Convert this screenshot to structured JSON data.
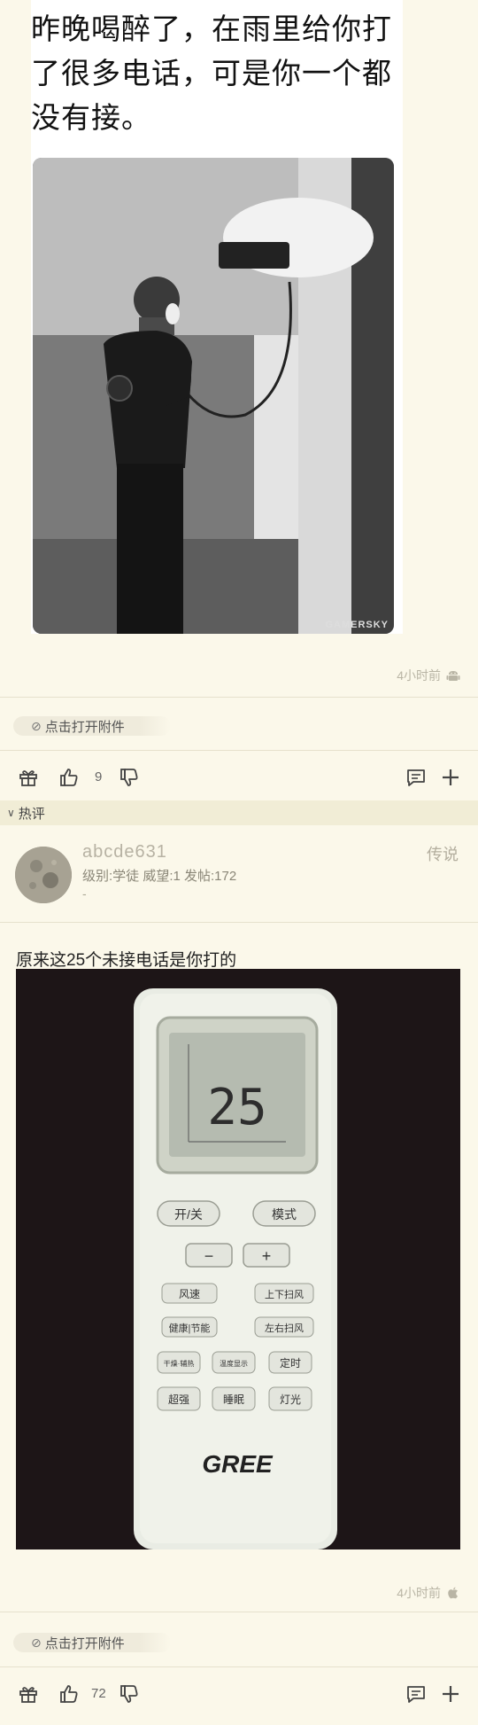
{
  "post": {
    "meme_caption": [
      "昨晚喝醉了，在雨里给你打",
      "了很多电话，可是你一个都",
      "没有接。"
    ],
    "watermark": "GAMERSKY",
    "time": "4小时前",
    "os_icon": "android-icon",
    "attachment_label": "点击打开附件",
    "likes": "9"
  },
  "hot_section": {
    "label": "热评"
  },
  "reply": {
    "username": "abcde631",
    "meta": "级别:学徒 威望:1 发帖:172",
    "dash": "-",
    "floor": "传说",
    "text": "原来这25个未接电话是你打的",
    "remote": {
      "display": "25",
      "buttons": [
        "开/关",
        "模式",
        "−",
        "+",
        "风速",
        "上下扫风",
        "健康|节能",
        "左右扫风",
        "干燥·辅热",
        "温度显示",
        "定时",
        "超强",
        "睡眠",
        "灯光"
      ],
      "brand": "GREE"
    },
    "time": "4小时前",
    "os_icon": "apple-icon",
    "attachment_label": "点击打开附件",
    "likes": "72"
  }
}
